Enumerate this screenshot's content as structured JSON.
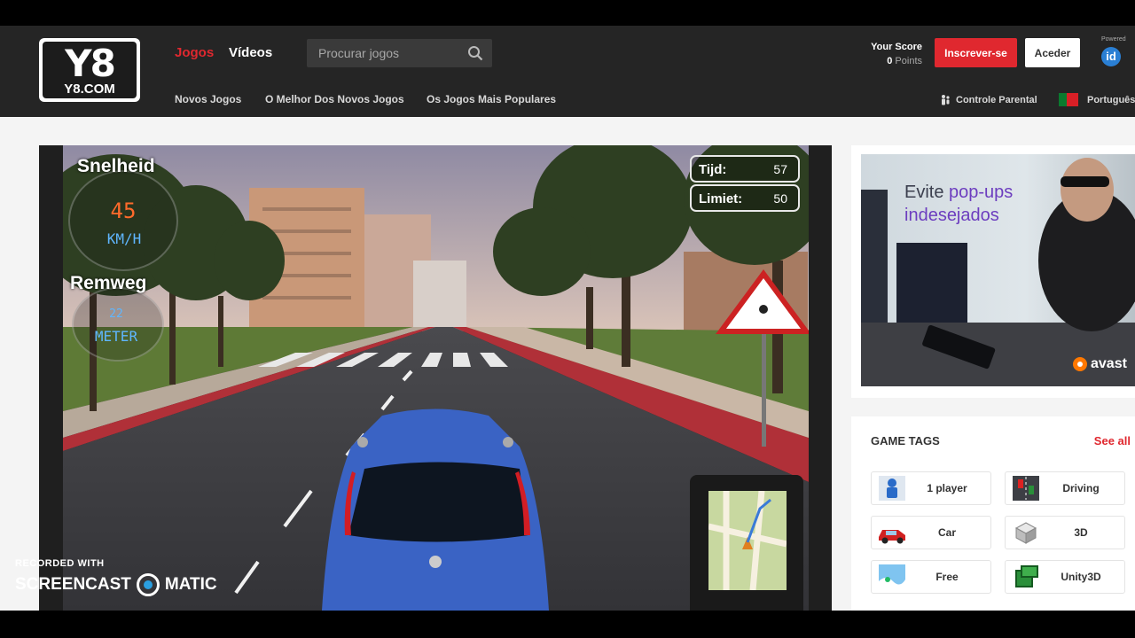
{
  "header": {
    "logo_big": "Y8",
    "logo_small": "Y8.COM",
    "nav": {
      "games": "Jogos",
      "videos": "Vídeos"
    },
    "search": {
      "placeholder": "Procurar jogos",
      "icon": "search-icon"
    },
    "subnav": [
      "Novos Jogos",
      "O Melhor Dos Novos Jogos",
      "Os Jogos Mais Populares"
    ],
    "score": {
      "label": "Your Score",
      "value": "0",
      "unit": "Points"
    },
    "register_label": "Inscrever-se",
    "login_label": "Aceder",
    "powered": "Powered",
    "id_logo": "id",
    "parental_control": "Controle Parental",
    "language": "Português"
  },
  "game": {
    "speed_label": "Snelheid",
    "speed_value": "45",
    "speed_unit": "KM/H",
    "brake_label": "Remweg",
    "brake_value": "22",
    "brake_unit": "METER",
    "time_label": "Tijd:",
    "time_value": "57",
    "limit_label": "Limiet:",
    "limit_value": "50"
  },
  "ad": {
    "line1_prefix": "Evite ",
    "line1_highlight": "pop-ups",
    "line2": "indesejados",
    "brand": "avast"
  },
  "tags": {
    "title": "GAME TAGS",
    "see_all": "See all",
    "items": [
      {
        "label": "1 player",
        "icon": "player-icon"
      },
      {
        "label": "Driving",
        "icon": "driving-icon"
      },
      {
        "label": "Car",
        "icon": "car-icon"
      },
      {
        "label": "3D",
        "icon": "cube-icon"
      },
      {
        "label": "Free",
        "icon": "free-icon"
      },
      {
        "label": "Unity3D",
        "icon": "unity3d-icon"
      }
    ]
  },
  "watermark": {
    "line1": "RECORDED WITH",
    "line2a": "SCREENCAST",
    "line2b": "MATIC"
  },
  "colors": {
    "accent": "#e0282f",
    "header_bg": "#252525",
    "page_bg": "#f4f4f4"
  }
}
